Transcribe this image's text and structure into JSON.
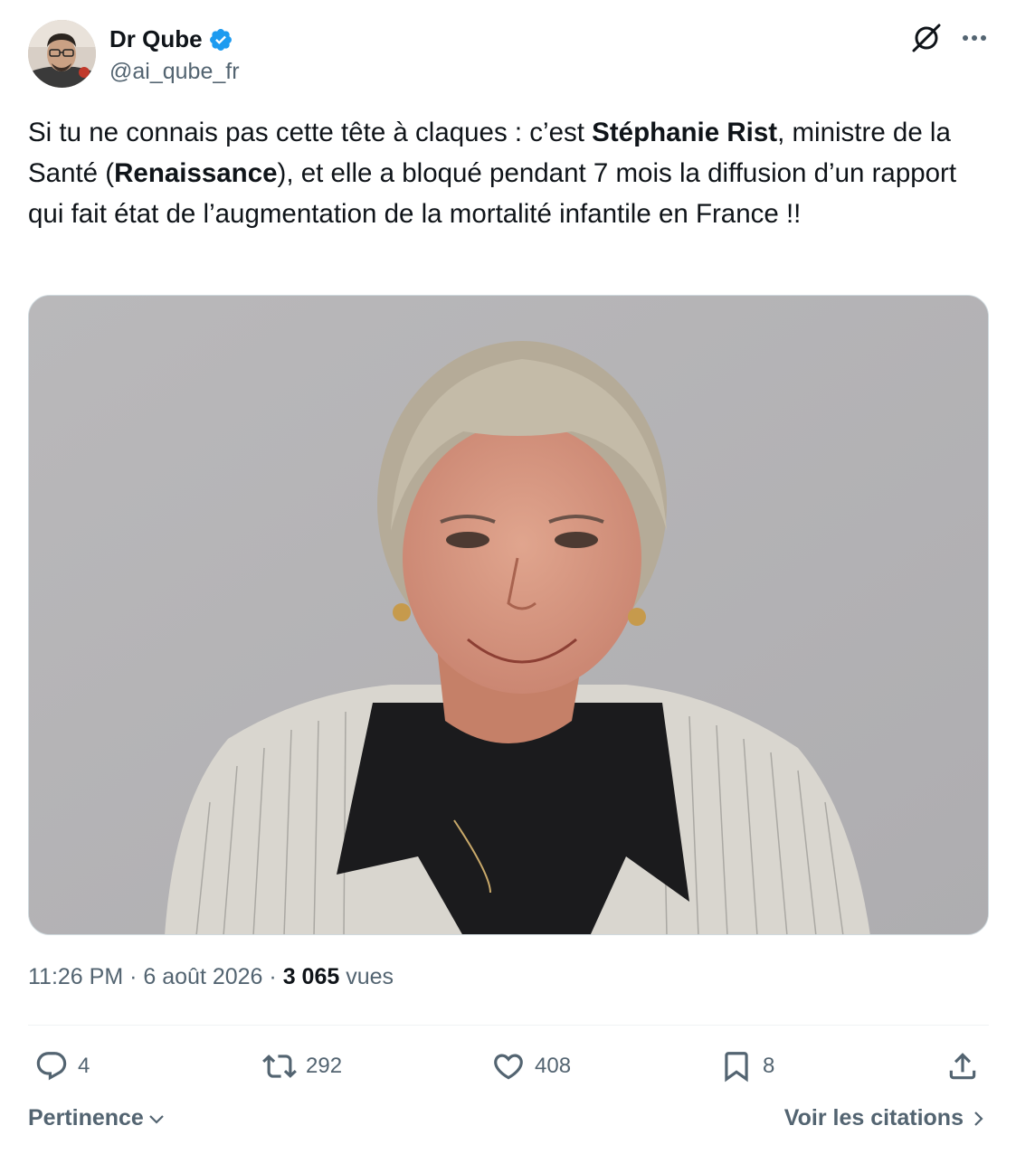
{
  "author": {
    "display_name": "Dr Qube",
    "handle": "@ai_qube_fr",
    "verified": true
  },
  "tweet": {
    "text_parts": [
      {
        "text": "Si tu ne connais pas cette tête à claques : c’est ",
        "bold": false
      },
      {
        "text": "Stéphanie Rist",
        "bold": true
      },
      {
        "text": ", ministre de la Santé (",
        "bold": false
      },
      {
        "text": "Renaissance",
        "bold": true
      },
      {
        "text": "), et elle a bloqué pendant 7 mois la diffusion d’un rapport qui fait état de l’augmentation de la mortalité infantile en France !!",
        "bold": false
      }
    ]
  },
  "meta": {
    "time": "11:26 PM",
    "sep1": "·",
    "date": "6 août 2026",
    "sep2": "·",
    "views_count": "3 065",
    "views_label": "vues"
  },
  "actions": {
    "replies": "4",
    "reposts": "292",
    "likes": "408",
    "bookmarks": "8"
  },
  "footer": {
    "sort_label": "Pertinence",
    "quotes_label": "Voir les citations"
  },
  "icons": [
    "grok-icon",
    "more-icon",
    "verified-badge-icon",
    "reply-icon",
    "repost-icon",
    "like-icon",
    "bookmark-icon",
    "share-icon",
    "chevron-down-icon",
    "chevron-right-icon"
  ],
  "colors": {
    "text": "#0f1419",
    "secondary": "#536471",
    "verified": "#1d9bf0",
    "divider": "#eff3f4"
  }
}
